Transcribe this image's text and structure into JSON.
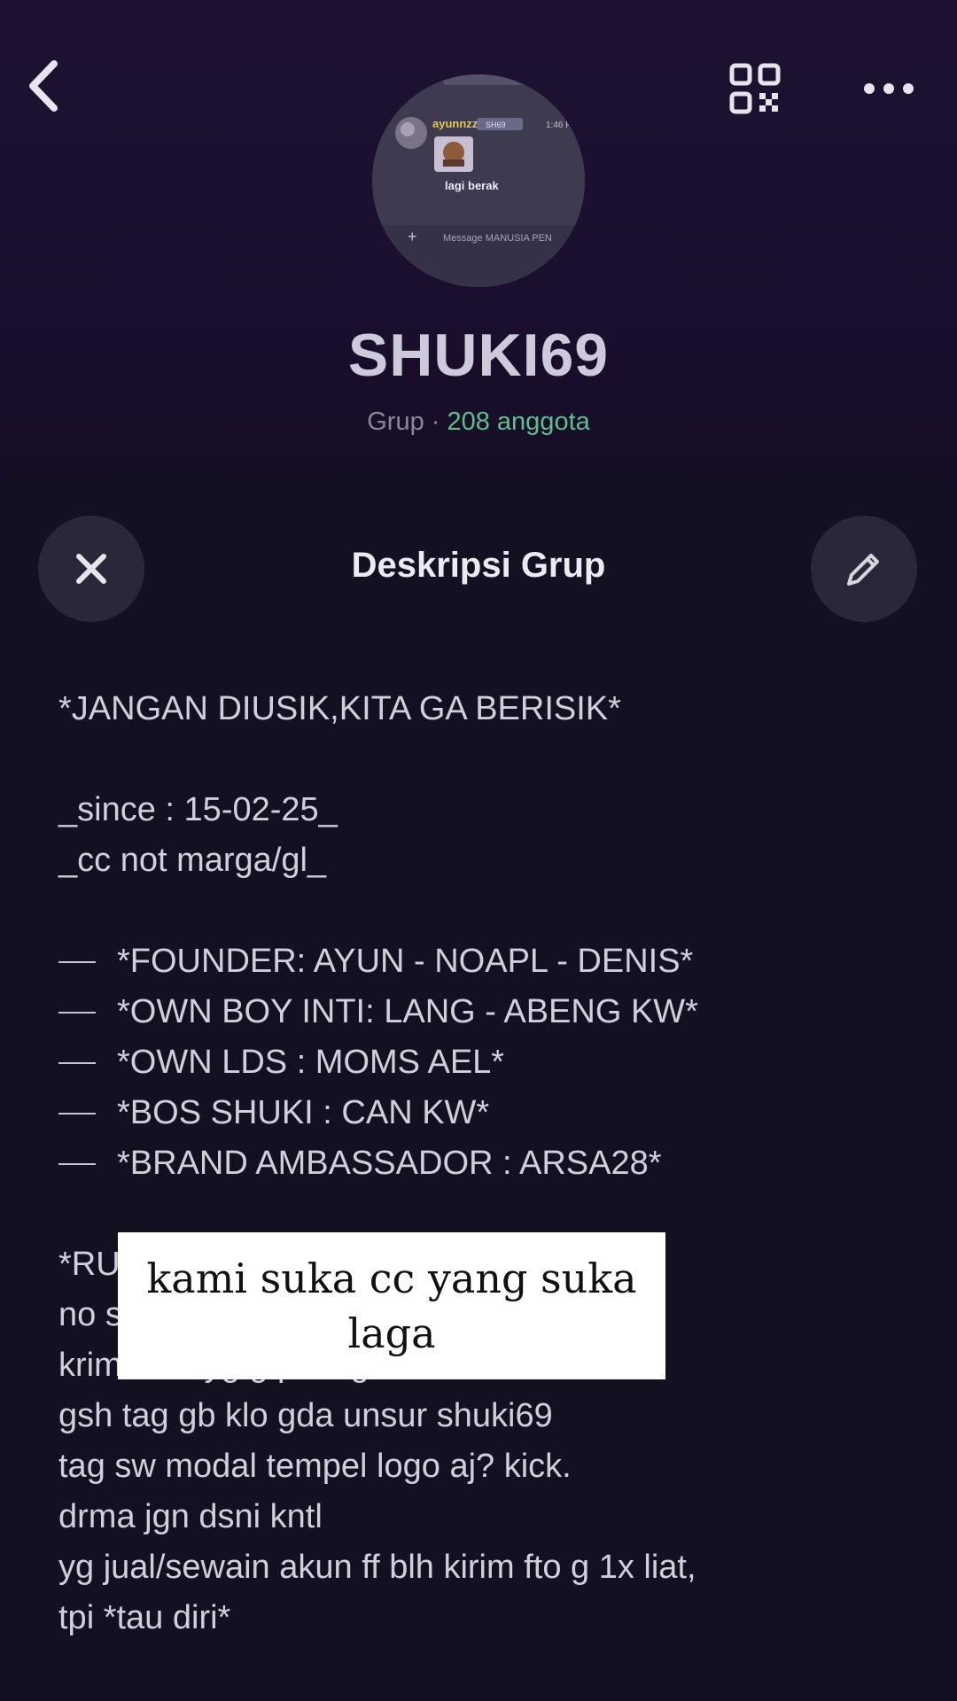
{
  "colors": {
    "header_bg": "#1e1230",
    "sheet_bg": "#131121",
    "member_count": "#5fbf8c",
    "button_bg": "#2a2838"
  },
  "header": {
    "back_icon": "chevron-left-icon",
    "qr_icon": "qr-code-icon",
    "more_icon": "more-horizontal-icon",
    "avatar": {
      "username": "ayunnzz",
      "badge": "SH69",
      "time": "1:46 P",
      "message": "lagi berak",
      "input_placeholder": "Message MANUSIA PEN"
    },
    "group_name": "SHUKI69",
    "group_type": "Grup · ",
    "member_count": "208 anggota"
  },
  "sheet": {
    "title": "Deskripsi Grup",
    "close_icon": "close-icon",
    "edit_icon": "pencil-icon",
    "description": {
      "headline": "*JANGAN DIUSIK,KITA GA BERISIK*",
      "since": "_since : 15-02-25_",
      "cc": "_cc not marga/gl_",
      "roles": [
        "*FOUNDER: AYUN - NOAPL - DENIS*",
        "*OWN BOY INTI: LANG - ABENG KW*",
        "*OWN LDS : MOMS AEL*",
        "*BOS SHUKI : CAN KW*",
        "*BRAND AMBASSADOR : ARSA28*"
      ],
      "rules_header": "*RU",
      "rule_partial": "no s",
      "rule_cut": "krim ft/vd yg g pnting skli liat",
      "rules": [
        "gsh tag gb klo gda unsur shuki69",
        "tag sw modal tempel logo aj? kick.",
        "drma jgn dsni kntl",
        "yg jual/sewain akun ff blh kirim fto g 1x liat,",
        "tpi *tau diri*"
      ]
    }
  },
  "caption": {
    "text": "kami suka cc yang suka laga"
  }
}
